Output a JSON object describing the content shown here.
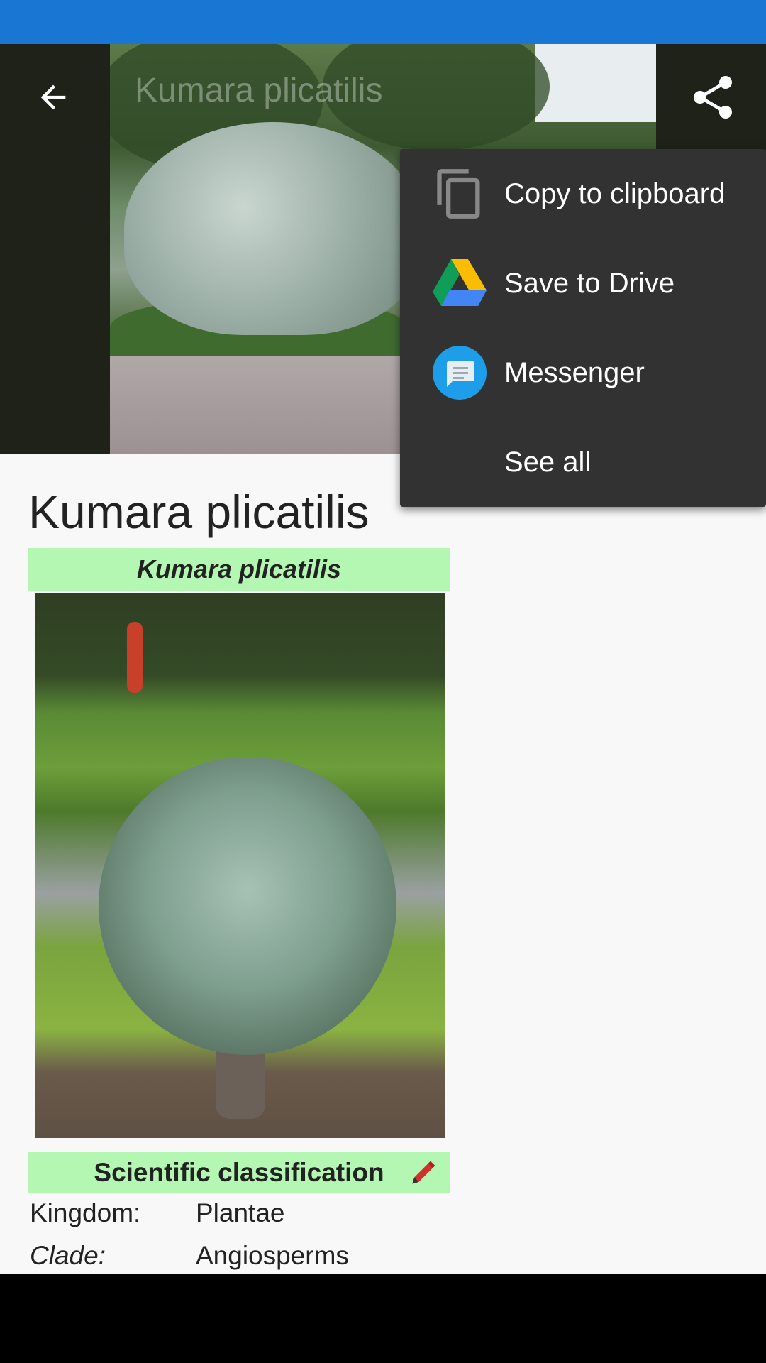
{
  "toolbar": {
    "title": "Kumara plicatilis",
    "back_icon": "arrow-left-icon",
    "share_icon": "share-icon"
  },
  "share_menu": {
    "items": [
      {
        "label": "Copy to clipboard",
        "icon": "copy-icon"
      },
      {
        "label": "Save to Drive",
        "icon": "google-drive-icon"
      },
      {
        "label": "Messenger",
        "icon": "messenger-icon"
      },
      {
        "label": "See all"
      }
    ]
  },
  "article": {
    "title": "Kumara plicatilis",
    "infobox_title": "Kumara plicatilis",
    "classification_header": "Scientific classification",
    "classification": [
      {
        "rank": "Kingdom:",
        "value": "Plantae"
      },
      {
        "rank": "Clade:",
        "value": "Angiosperms"
      }
    ]
  },
  "colors": {
    "status_bar": "#1976d2",
    "infobox_green": "#b3f7b3",
    "menu_bg": "#323232"
  }
}
